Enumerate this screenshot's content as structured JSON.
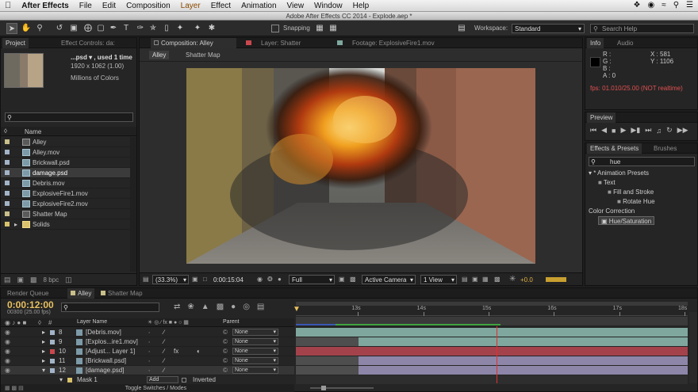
{
  "menubar": {
    "apple": "",
    "app": "After Effects",
    "items": [
      "File",
      "Edit",
      "Composition",
      "Layer",
      "Effect",
      "Animation",
      "View",
      "Window",
      "Help"
    ],
    "highlight": "Layer"
  },
  "titlebar": {
    "title": "Adobe After Effects CC 2014 - Explode.aep *"
  },
  "toolbar": {
    "snapping": "Snapping",
    "workspace_label": "Workspace:",
    "workspace_value": "Standard",
    "search_placeholder": "Search Help"
  },
  "project": {
    "tabs": [
      "Project",
      "Effect Controls: da:"
    ],
    "info_name": "...psd ▾ , used 1 time",
    "info_dims": "1920 x 1062 (1.00)",
    "info_colors": "Millions of Colors",
    "col_name": "Name",
    "items": [
      {
        "name": "Alley",
        "color": "#c9bf8a",
        "type": "comp"
      },
      {
        "name": "Alley.mov",
        "color": "#a3b4c8",
        "type": "file"
      },
      {
        "name": "Brickwall.psd",
        "color": "#a3b4c8",
        "type": "file"
      },
      {
        "name": "damage.psd",
        "color": "#a3b4c8",
        "type": "file",
        "selected": true
      },
      {
        "name": "Debris.mov",
        "color": "#a3b4c8",
        "type": "file"
      },
      {
        "name": "ExplosiveFire1.mov",
        "color": "#a3b4c8",
        "type": "file"
      },
      {
        "name": "ExplosiveFire2.mov",
        "color": "#a3b4c8",
        "type": "file"
      },
      {
        "name": "Shatter Map",
        "color": "#c9bf8a",
        "type": "comp"
      },
      {
        "name": "Solids",
        "color": "#d9c26b",
        "type": "folder"
      }
    ],
    "bpc": "8 bpc"
  },
  "viewer": {
    "tabs": [
      "Composition: Alley",
      "Layer: Shatter",
      "Footage: ExplosiveFire1.mov"
    ],
    "breadcrumbs": [
      "Alley",
      "Shatter Map"
    ],
    "zoom": "(33.3%)",
    "timecode": "0:00:15:04",
    "resolution": "Full",
    "camera": "Active Camera",
    "views": "1 View",
    "exposure": "+0.0"
  },
  "info": {
    "tabs": [
      "Info",
      "Audio"
    ],
    "r": "R :",
    "g": "G :",
    "b": "B :",
    "a": "A : 0",
    "x": "X : 581",
    "y": "Y : 1106",
    "fps": "fps: 01.010/25.00 (NOT realtime)"
  },
  "preview": {
    "title": "Preview"
  },
  "effects": {
    "tabs": [
      "Effects & Presets",
      "Brushes"
    ],
    "search": "hue",
    "tree": [
      {
        "label": "▾ * Animation Presets",
        "indent": 0
      },
      {
        "label": "Text",
        "indent": 1
      },
      {
        "label": "Fill and Stroke",
        "indent": 2
      },
      {
        "label": "Rotate Hue",
        "indent": 3
      },
      {
        "label": "Color Correction",
        "indent": 0
      },
      {
        "label": "Hue/Saturation",
        "indent": 1,
        "selected": true
      }
    ]
  },
  "timeline": {
    "tabs": [
      "Render Queue",
      "Alley",
      "Shatter Map"
    ],
    "timecode": "0:00:12:00",
    "frames": "00300 (25.00 fps)",
    "col_layer": "Layer Name",
    "col_parent": "Parent",
    "ruler": [
      "13s",
      "14s",
      "15s",
      "16s",
      "17s",
      "18s"
    ],
    "layers": [
      {
        "num": "8",
        "name": "[Debris.mov]",
        "color": "#a3b4c8",
        "parent": "None",
        "bar_color": "#7fa79e",
        "bar_start": 0.0,
        "bar_end": 1.0
      },
      {
        "num": "9",
        "name": "[Explos...ire1.mov]",
        "color": "#a3b4c8",
        "parent": "None",
        "bar_color": "#7fa79e",
        "bar_start": 0.16,
        "bar_end": 1.0
      },
      {
        "num": "10",
        "name": "[Adjust... Layer 1]",
        "color": "#c9474e",
        "parent": "None",
        "bar_color": "#a3424b",
        "bar_start": 0.0,
        "bar_end": 1.0
      },
      {
        "num": "11",
        "name": "[Brickwall.psd]",
        "color": "#a3b4c8",
        "parent": "None",
        "bar_color": "#8d86a8",
        "bar_start": 0.16,
        "bar_end": 1.0
      },
      {
        "num": "12",
        "name": "[damage.psd]",
        "color": "#a3b4c8",
        "parent": "None",
        "bar_color": "#8d86a8",
        "bar_start": 0.16,
        "bar_end": 1.0,
        "selected": true
      }
    ],
    "mask": "Mask 1",
    "mask_mode": "Add",
    "mask_inverted": "Inverted",
    "toggle": "Toggle Switches / Modes"
  }
}
